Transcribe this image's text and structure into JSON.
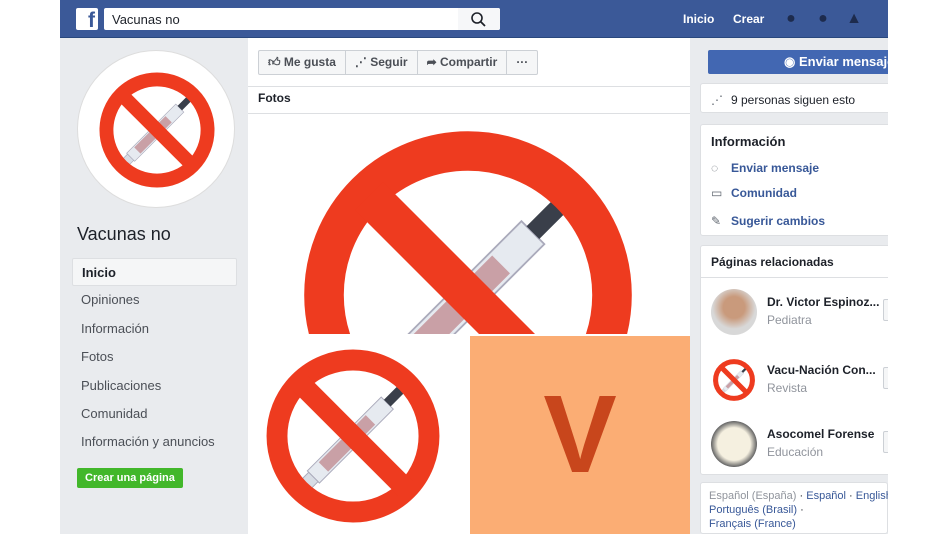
{
  "header": {
    "search_value": "Vacunas no",
    "nav": [
      "Inicio",
      "Crear"
    ],
    "icons": [
      "friends-icon",
      "messenger-icon",
      "notifications-icon"
    ]
  },
  "sidebar": {
    "page_name": "Vacunas no",
    "items": [
      {
        "label": "Inicio",
        "active": true
      },
      {
        "label": "Opiniones"
      },
      {
        "label": "Información"
      },
      {
        "label": "Fotos"
      },
      {
        "label": "Publicaciones"
      },
      {
        "label": "Comunidad"
      },
      {
        "label": "Información y anuncios"
      }
    ],
    "create_page": "Crear una página"
  },
  "actions": {
    "like": "Me gusta",
    "follow": "Seguir",
    "share": "Compartir",
    "more": "···"
  },
  "photos": {
    "title": "Fotos",
    "tile_letter": "V"
  },
  "right": {
    "send_message": "Enviar mensaje",
    "followers": "9 personas siguen esto",
    "info": {
      "title": "Información",
      "items": [
        "Enviar mensaje",
        "Comunidad",
        "Sugerir cambios"
      ]
    },
    "related": {
      "title": "Páginas relacionadas",
      "pages": [
        {
          "name": "Dr. Victor Espinoz...",
          "category": "Pediatra"
        },
        {
          "name": "Vacu-Nación Con...",
          "category": "Revista"
        },
        {
          "name": "Asocomel Forense",
          "category": "Educación"
        }
      ]
    },
    "languages": {
      "line1": [
        "Español (España)",
        "Español",
        "English"
      ],
      "line2": [
        "Português (Brasil)",
        "Français (France)"
      ]
    }
  },
  "colors": {
    "brand": "#3b5998",
    "button": "#4267b2",
    "create": "#42b72a",
    "no_sign": "#ee3b1f",
    "tile": "#fbad74",
    "tile_letter": "#c8461c"
  }
}
